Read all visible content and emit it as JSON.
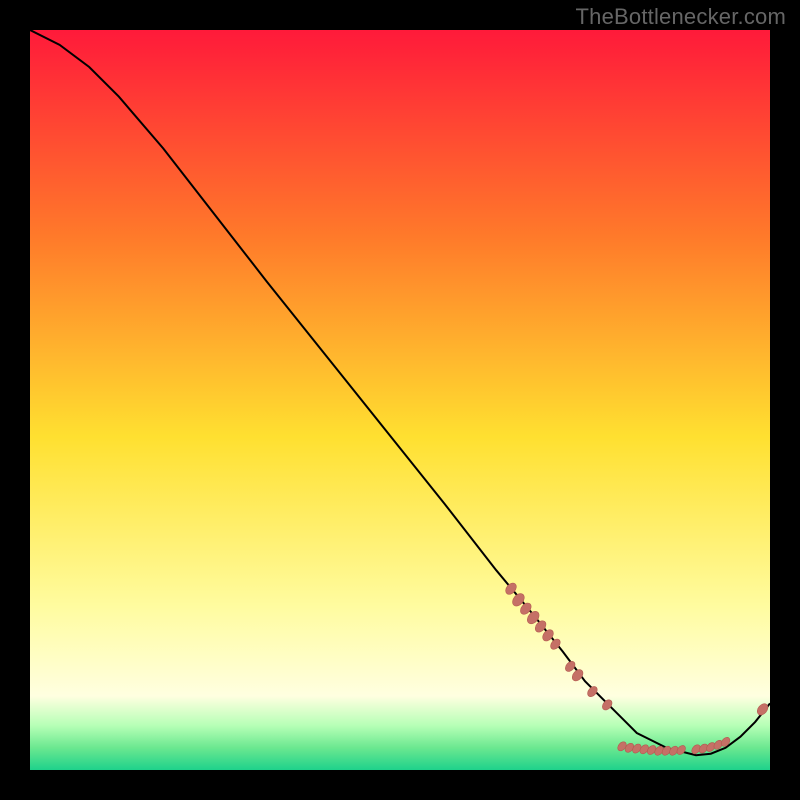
{
  "watermark": "TheBottlenecker.com",
  "colors": {
    "bg_black": "#000000",
    "grad_top": "#ff1a3a",
    "grad_mid_upper": "#ff7a2a",
    "grad_mid": "#ffe030",
    "grad_mid_lower": "#fffca0",
    "grad_low_yellow": "#ffffe0",
    "grad_green1": "#b6ffb6",
    "grad_green2": "#6be890",
    "grad_green3": "#1ed28b",
    "curve": "#000000",
    "marker_fill": "#c57066",
    "marker_stroke": "#b35a50"
  },
  "chart_data": {
    "type": "line",
    "title": "",
    "xlabel": "",
    "ylabel": "",
    "xlim": [
      0,
      100
    ],
    "ylim": [
      0,
      100
    ],
    "series": [
      {
        "name": "bottleneck-curve",
        "x": [
          0,
          4,
          8,
          12,
          18,
          25,
          32,
          40,
          48,
          56,
          63,
          68,
          72,
          75,
          78,
          80,
          82,
          84,
          86,
          88,
          90,
          92,
          94,
          96,
          98,
          100
        ],
        "y": [
          100,
          98,
          95,
          91,
          84,
          75,
          66,
          56,
          46,
          36,
          27,
          21,
          16,
          12,
          9,
          7,
          5,
          4,
          3,
          2.5,
          2,
          2.2,
          3,
          4.5,
          6.5,
          9
        ]
      }
    ],
    "markers": [
      {
        "x": 65,
        "y": 24.5,
        "r": 2.0
      },
      {
        "x": 66,
        "y": 23.0,
        "r": 2.2
      },
      {
        "x": 67,
        "y": 21.8,
        "r": 2.0
      },
      {
        "x": 68,
        "y": 20.6,
        "r": 2.2
      },
      {
        "x": 69,
        "y": 19.4,
        "r": 2.0
      },
      {
        "x": 70,
        "y": 18.2,
        "r": 2.0
      },
      {
        "x": 71,
        "y": 17.0,
        "r": 1.8
      },
      {
        "x": 73,
        "y": 14.0,
        "r": 1.8
      },
      {
        "x": 74,
        "y": 12.8,
        "r": 2.0
      },
      {
        "x": 76,
        "y": 10.6,
        "r": 1.8
      },
      {
        "x": 78,
        "y": 8.8,
        "r": 1.8
      },
      {
        "x": 80,
        "y": 3.2,
        "r": 1.6
      },
      {
        "x": 81,
        "y": 3.0,
        "r": 1.6
      },
      {
        "x": 82,
        "y": 2.9,
        "r": 1.6
      },
      {
        "x": 83,
        "y": 2.8,
        "r": 1.6
      },
      {
        "x": 84,
        "y": 2.7,
        "r": 1.6
      },
      {
        "x": 85,
        "y": 2.6,
        "r": 1.6
      },
      {
        "x": 86,
        "y": 2.6,
        "r": 1.6
      },
      {
        "x": 87,
        "y": 2.6,
        "r": 1.6
      },
      {
        "x": 88,
        "y": 2.7,
        "r": 1.6
      },
      {
        "x": 90,
        "y": 2.8,
        "r": 1.6
      },
      {
        "x": 91,
        "y": 2.9,
        "r": 1.6
      },
      {
        "x": 92,
        "y": 3.1,
        "r": 1.6
      },
      {
        "x": 93,
        "y": 3.4,
        "r": 1.6
      },
      {
        "x": 94,
        "y": 3.8,
        "r": 1.6
      },
      {
        "x": 99,
        "y": 8.2,
        "r": 2.0
      }
    ]
  }
}
